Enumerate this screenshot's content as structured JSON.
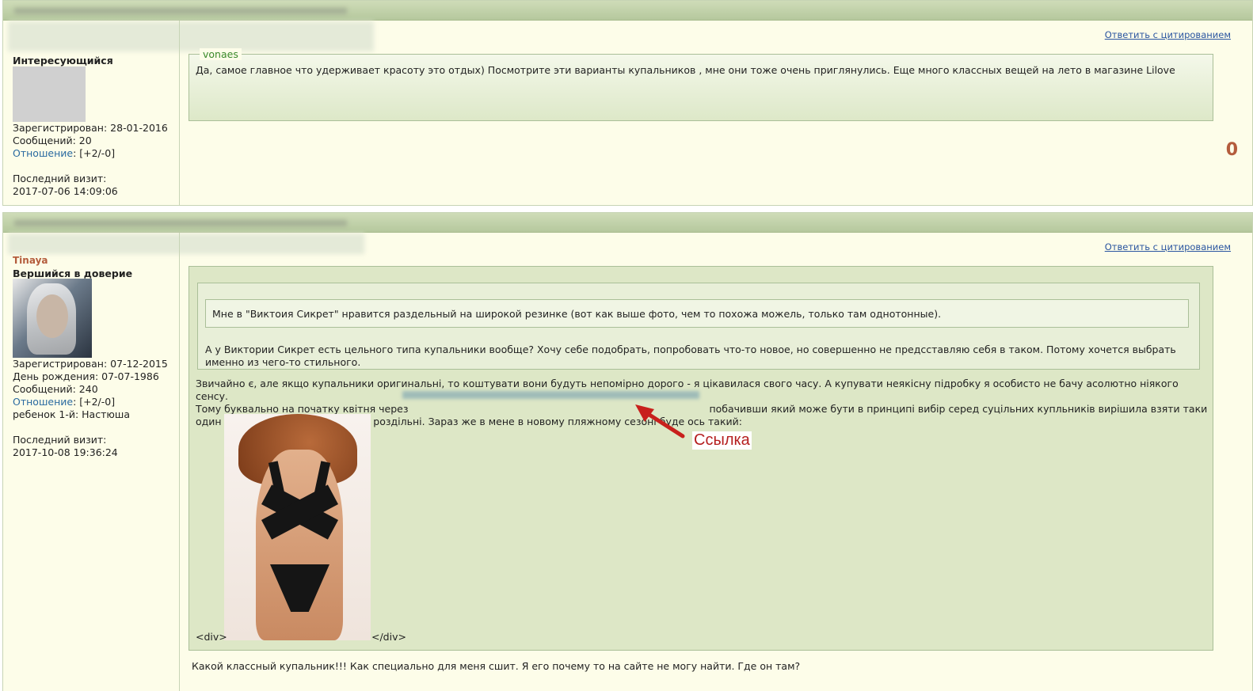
{
  "post1": {
    "reply_label": "Ответить с цитированием",
    "user_rank": "Интересующийся",
    "registered": "Зарегистрирован: 28-01-2016",
    "messages": "Сообщений: 20",
    "relation_label": "Отношение",
    "relation_value": ": [+2/-0]",
    "last_visit_label": "Последний визит:",
    "last_visit_value": "2017-07-06 14:09:06",
    "quote_author": "vonaes",
    "quote_text": "Да, самое главное что удерживает красоту это отдых) Посмотрите эти варианты купальников , мне они тоже очень приглянулись. Еще много классных вещей на лето в магазине Lilove",
    "rating": "0"
  },
  "post2": {
    "reply_label": "Ответить с цитированием",
    "user_name": "Tinaya",
    "user_rank": "Вершийся в доверие",
    "registered": "Зарегистрирован: 07-12-2015",
    "birthday": "День рождения: 07-07-1986",
    "messages": "Сообщений: 240",
    "relation_label": "Отношение",
    "relation_value": ": [+2/-0]",
    "child": "ребенок 1-й: Настюша",
    "last_visit_label": "Последний визит:",
    "last_visit_value": "2017-10-08 19:36:24",
    "inner_quote_text": "Мне в \"Виктоия Сикрет\" нравится раздельный на широкой резинке (вот как выше фото, чем то похожа можель, только там однотонные).",
    "quote_text": "А у Виктории Сикрет есть цельного типа купальники вообще? Хочу себе подобрать, попробовать что-то новое, но совершенно не предсставляю себя в таком. Потому хочется выбрать именно из чего-то стильного.",
    "body_line1": "Звичайно є, але якщо купальники оригинальні, то коштувати вони будуть непомірно дорого - я цікавилася свого часу. А купувати неякісну підробку я особисто не бачу асолютно ніякого сенсу.",
    "body_line2_a": "Тому буквально на початку квітня через",
    "body_line2_b": "побачивши який може бути в принципі вибір серед суцільних купльників вирішила взяти таки",
    "body_line3": "один з них. Хоча до того були всі роздільні. Зараз же в мене в новому пляжному сезоні буде ось такий:",
    "div_open": "<div>",
    "div_close": "</div>",
    "reply_text": "Какой классный купальник!!! Как специально для меня сшит. Я его почему то на сайте не могу найти. Где он там?"
  },
  "annotation": {
    "label": "Ссылка",
    "color": "#b51f1f"
  },
  "colors": {
    "header": "#bccda4",
    "background": "#fdfde9",
    "quote": "#dde7c6",
    "link": "#2a55a0",
    "username": "#b45c3c"
  }
}
